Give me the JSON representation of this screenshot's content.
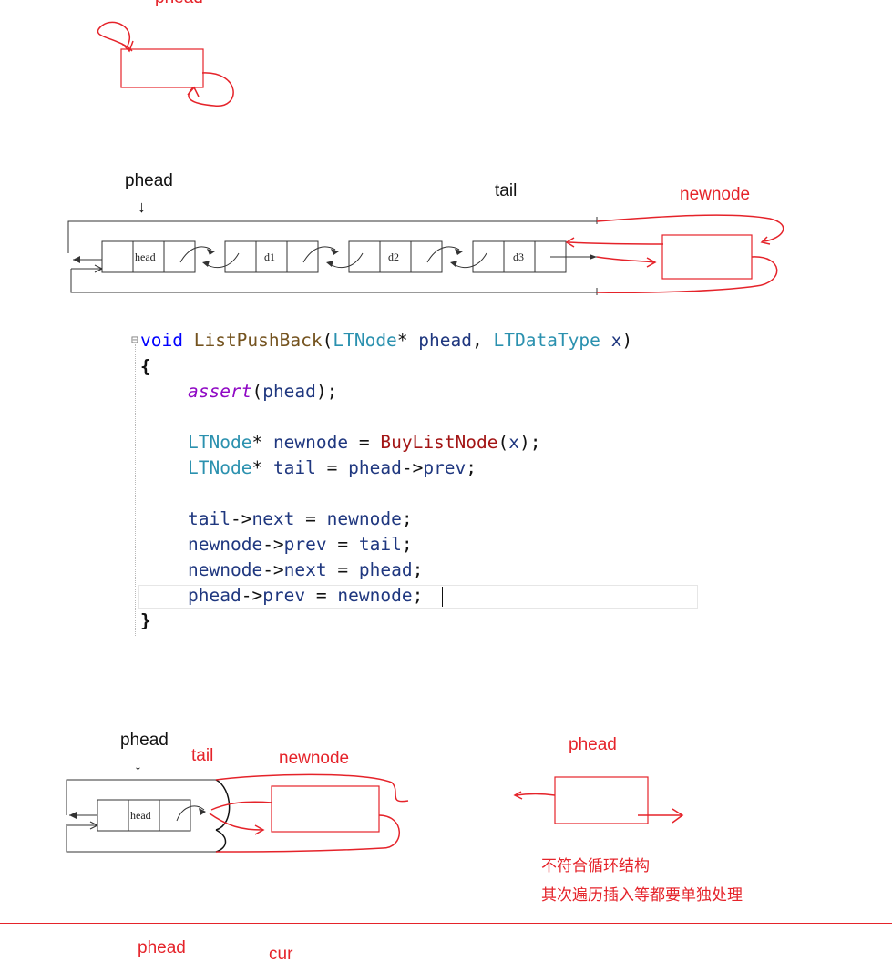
{
  "top": {
    "label_phead": "phead"
  },
  "middle": {
    "label_phead": "phead",
    "label_tail": "tail",
    "label_newnode": "newnode",
    "nodes": [
      "head",
      "d1",
      "d2",
      "d3"
    ]
  },
  "code": {
    "line1": {
      "kw": "void",
      "fn": "ListPushBack",
      "open": "(",
      "type1": "LTNode",
      "star1": "* ",
      "param1": "phead",
      "comma": ", ",
      "type2": "LTDataType",
      "sp": " ",
      "param2": "x",
      "close": ")"
    },
    "line2": "{",
    "line3": {
      "macro": "assert",
      "rest_open": "(",
      "arg": "phead",
      "rest_close": ");"
    },
    "line5": {
      "type": "LTNode",
      "star": "* ",
      "var": "newnode",
      "eq": " = ",
      "fn": "BuyListNode",
      "open": "(",
      "arg": "x",
      "close": ");"
    },
    "line6": {
      "type": "LTNode",
      "star": "* ",
      "var": "tail",
      "eq": " = ",
      "lhs": "phead",
      "arrow": "->",
      "field": "prev",
      "end": ";"
    },
    "line8": {
      "a": "tail",
      "arrow": "->",
      "field": "next",
      "eq": " = ",
      "b": "newnode",
      "end": ";"
    },
    "line9": {
      "a": "newnode",
      "arrow": "->",
      "field": "prev",
      "eq": " = ",
      "b": "tail",
      "end": ";"
    },
    "line10": {
      "a": "newnode",
      "arrow": "->",
      "field": "next",
      "eq": " = ",
      "b": "phead",
      "end": ";"
    },
    "line11": {
      "a": "phead",
      "arrow": "->",
      "field": "prev",
      "eq": " = ",
      "b": "newnode",
      "end": ";"
    },
    "line12": "}"
  },
  "bottom": {
    "label_phead": "phead",
    "label_tail": "tail",
    "label_newnode": "newnode",
    "node_head": "head",
    "right_label_phead": "phead",
    "note_line1": "不符合循环结构",
    "note_line2": "其次遍历插入等都要单独处理"
  },
  "footer": {
    "label_phead": "phead",
    "label_cur": "cur"
  },
  "colors": {
    "red_ink": "#e5232a",
    "keyword": "#0000ff",
    "type": "#2b91af",
    "function": "#74531f",
    "variable": "#1f377f",
    "macro": "#8f08c4"
  }
}
